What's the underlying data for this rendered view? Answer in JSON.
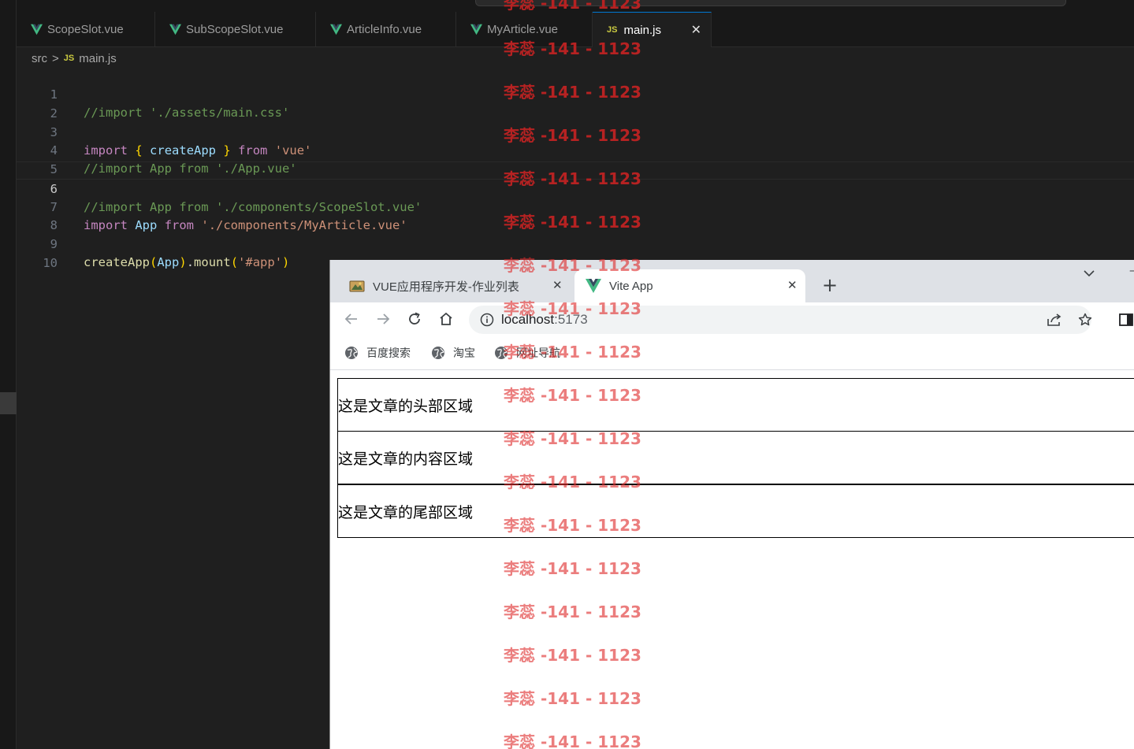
{
  "editor": {
    "tabs": [
      {
        "label": "ScopeSlot.vue",
        "icon": "vue-icon"
      },
      {
        "label": "SubScopeSlot.vue",
        "icon": "vue-icon"
      },
      {
        "label": "ArticleInfo.vue",
        "icon": "vue-icon"
      },
      {
        "label": "MyArticle.vue",
        "icon": "vue-icon"
      },
      {
        "label": "main.js",
        "icon": "js-icon",
        "active": true
      }
    ],
    "js_badge": "JS",
    "breadcrumb": {
      "folder": "src",
      "separator": ">",
      "file": "main.js"
    },
    "line_numbers": [
      "1",
      "2",
      "3",
      "4",
      "5",
      "6",
      "7",
      "8",
      "9",
      "10"
    ],
    "current_line": 6,
    "code": {
      "l1_comment": "//import './assets/main.css'",
      "l3_import": "import",
      "l3_brace_open": "{",
      "l3_name": "createApp",
      "l3_brace_close": "}",
      "l3_from": "from",
      "l3_module": "'vue'",
      "l4_comment": "//import App from './App.vue'",
      "l6_comment": "//import App from './components/ScopeSlot.vue'",
      "l7_import": "import",
      "l7_name": "App",
      "l7_from": "from",
      "l7_module": "'./components/MyArticle.vue'",
      "l9_fn": "createApp",
      "l9_paren_open": "(",
      "l9_arg": "App",
      "l9_paren_close": ")",
      "l9_dot": ".",
      "l9_mount": "mount",
      "l9_paren2_open": "(",
      "l9_sel": "'#app'",
      "l9_paren2_close": ")"
    }
  },
  "browser": {
    "tabs": [
      {
        "title": "VUE应用程序开发-作业列表",
        "icon": "folder-app-icon"
      },
      {
        "title": "Vite App",
        "icon": "vue-icon",
        "active": true
      }
    ],
    "url_host": "localhost",
    "url_port": ":5173",
    "bookmarks": [
      "百度搜索",
      "淘宝",
      "网址导航"
    ],
    "page": {
      "header_text": "这是文章的头部区域",
      "content_text": "这是文章的内容区域",
      "footer_text": "这是文章的尾部区域"
    }
  },
  "watermark": {
    "text": "李蕊 -141 - 1123",
    "color": "#de2d2d"
  },
  "colors": {
    "vue_green": "#42b883",
    "editor_bg": "#1f1f1f",
    "active_tab_accent": "#0078d4"
  }
}
